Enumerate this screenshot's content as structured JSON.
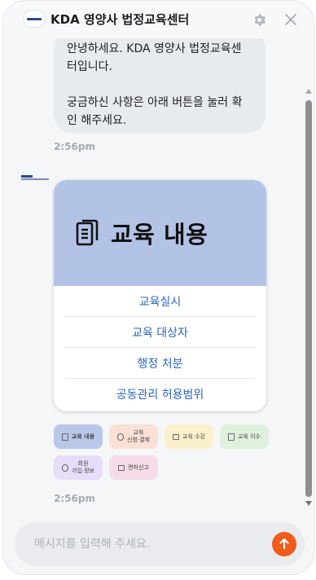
{
  "header": {
    "title": "KDA 영양사 법정교육센터",
    "settings_icon": "gear-icon",
    "close_icon": "close-icon"
  },
  "messages": [
    {
      "text": "안녕하세요. KDA 영양사 법정교육센\n터입니다.\n\n궁금하신 사항은 아래 버튼을 눌러 확\n인 해주세요.",
      "time": "2:56pm"
    }
  ],
  "card": {
    "icon": "document-icon",
    "title": "교육 내용",
    "hero_color": "#b3c3e6",
    "items": [
      "교육실시",
      "교육 대상자",
      "행정 처분",
      "공동관리 허용범위"
    ]
  },
  "chips": [
    {
      "label": "교육 내용",
      "color": "#b9c7e8",
      "icon": "document-icon"
    },
    {
      "label": "교육\n신청·결제",
      "color": "#fbe0d6",
      "icon": "payment-icon"
    },
    {
      "label": "교육 수강",
      "color": "#fbf0cc",
      "icon": "monitor-icon"
    },
    {
      "label": "교육 이수",
      "color": "#dff0dc",
      "icon": "certificate-icon"
    },
    {
      "label": "회원\n가입·정보",
      "color": "#e6ddf8",
      "icon": "user-icon"
    },
    {
      "label": "면허신고",
      "color": "#f6dce8",
      "icon": "license-icon"
    }
  ],
  "last_time": "2:56pm",
  "composer": {
    "placeholder": "메시지를 입력해 주세요.",
    "send_icon": "send-arrow-icon",
    "send_color": "#f05a1a"
  }
}
